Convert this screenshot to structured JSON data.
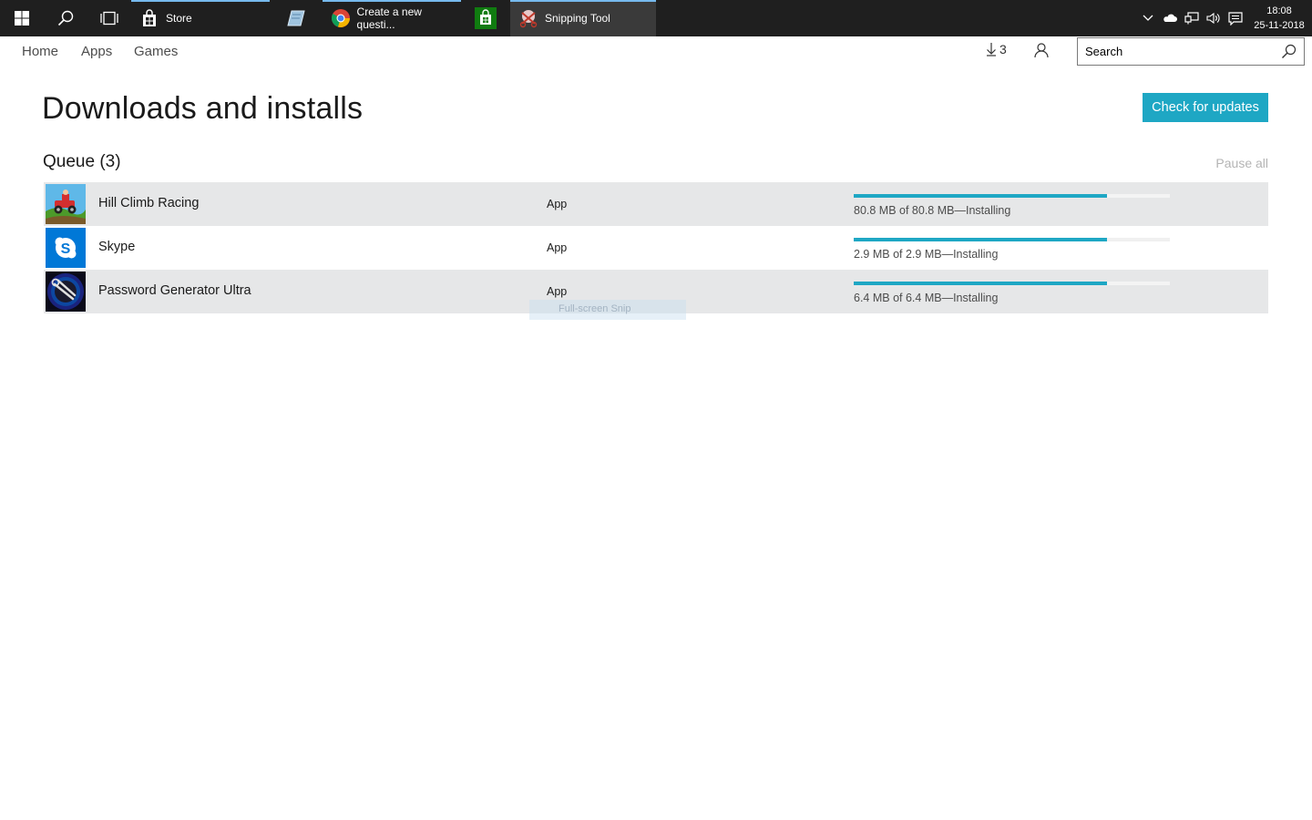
{
  "taskbar": {
    "apps": [
      {
        "label": "Store",
        "icon": "store-icon"
      },
      {
        "label": "",
        "icon": "notepad-icon"
      },
      {
        "label": "Create a new questi...",
        "icon": "chrome-icon"
      },
      {
        "label": "",
        "icon": "store-bag-icon"
      },
      {
        "label": "Snipping Tool",
        "icon": "snipping-tool-icon"
      }
    ],
    "clock": {
      "time": "18:08",
      "date": "25-11-2018"
    }
  },
  "nav": {
    "links": [
      "Home",
      "Apps",
      "Games"
    ],
    "download_count": "3",
    "search_placeholder": "Search"
  },
  "page": {
    "title": "Downloads and installs",
    "check_updates_label": "Check for updates",
    "queue_title": "Queue (3)",
    "pause_all_label": "Pause all"
  },
  "queue": [
    {
      "name": "Hill Climb Racing",
      "type": "App",
      "status": "80.8 MB of 80.8 MB—Installing",
      "progress": 0.8
    },
    {
      "name": "Skype",
      "type": "App",
      "status": "2.9 MB of 2.9 MB—Installing",
      "progress": 0.8
    },
    {
      "name": "Password Generator Ultra",
      "type": "App",
      "status": "6.4 MB of 6.4 MB—Installing",
      "progress": 0.8
    }
  ],
  "overlay": {
    "label": "Full-screen Snip"
  },
  "colors": {
    "accent": "#1ea7c4",
    "taskbar": "#1f1f1f",
    "row_alt": "#e6e7e8"
  }
}
